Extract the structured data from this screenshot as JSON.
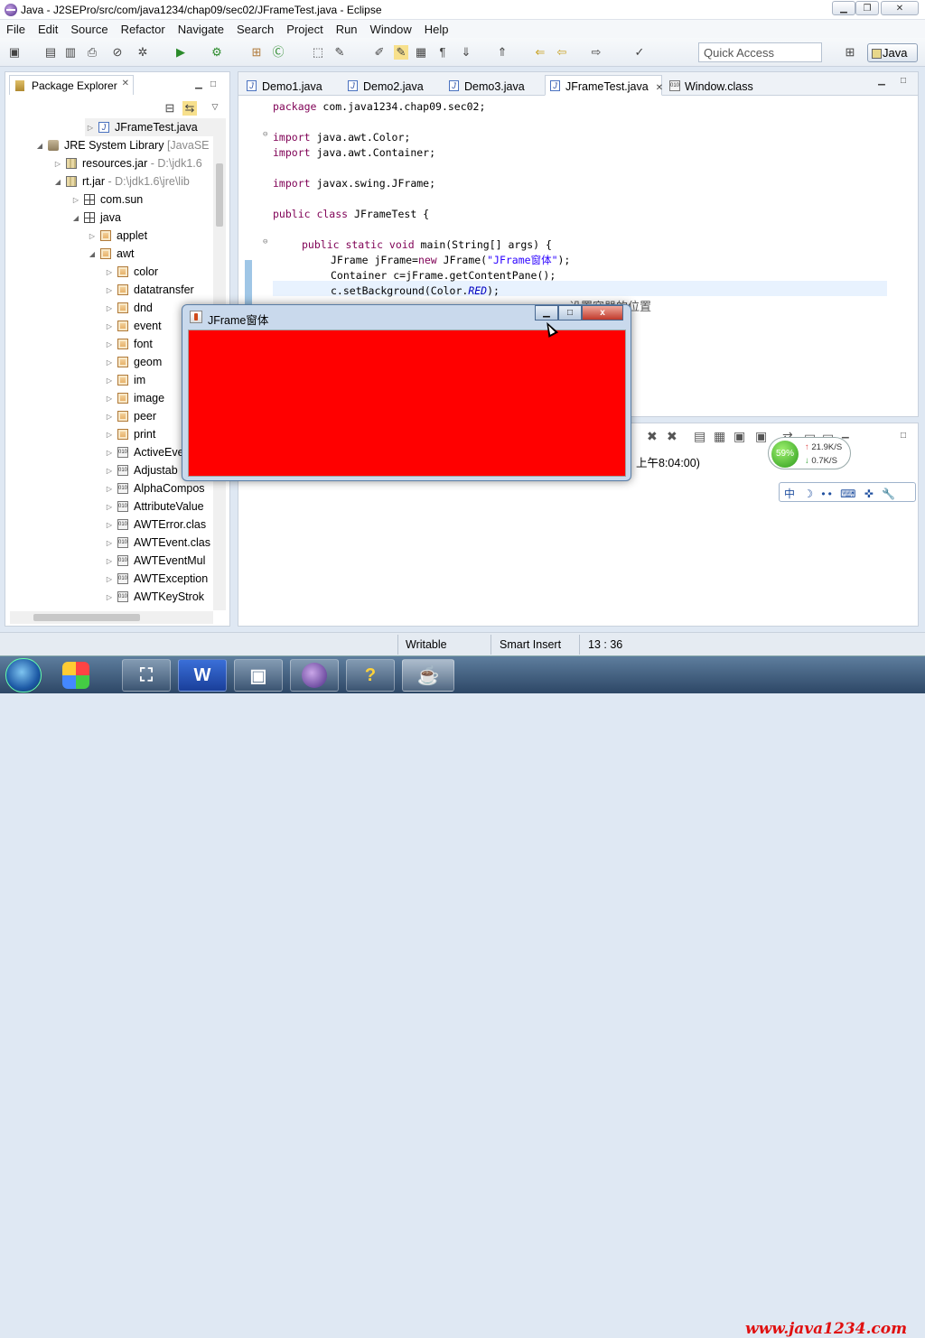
{
  "window": {
    "title": "Java - J2SEPro/src/com/java1234/chap09/sec02/JFrameTest.java - Eclipse"
  },
  "menu": [
    "File",
    "Edit",
    "Source",
    "Refactor",
    "Navigate",
    "Search",
    "Project",
    "Run",
    "Window",
    "Help"
  ],
  "toolbar": {
    "quick_access": "Quick Access",
    "perspective": "Java"
  },
  "package_explorer": {
    "tab_label": "Package Explorer",
    "items": [
      {
        "label": "JFrameTest.java",
        "suffix": ""
      },
      {
        "label": "JRE System Library",
        "suffix": "[JavaSE"
      },
      {
        "label": "resources.jar",
        "suffix": "- D:\\jdk1.6"
      },
      {
        "label": "rt.jar",
        "suffix": "- D:\\jdk1.6\\jre\\lib"
      },
      {
        "label": "com.sun",
        "suffix": ""
      },
      {
        "label": "java",
        "suffix": ""
      },
      {
        "label": "applet",
        "suffix": ""
      },
      {
        "label": "awt",
        "suffix": ""
      },
      {
        "label": "color",
        "suffix": ""
      },
      {
        "label": "datatransfer",
        "suffix": ""
      },
      {
        "label": "dnd",
        "suffix": ""
      },
      {
        "label": "event",
        "suffix": ""
      },
      {
        "label": "font",
        "suffix": ""
      },
      {
        "label": "geom",
        "suffix": ""
      },
      {
        "label": "im",
        "suffix": ""
      },
      {
        "label": "image",
        "suffix": ""
      },
      {
        "label": "peer",
        "suffix": ""
      },
      {
        "label": "print",
        "suffix": ""
      },
      {
        "label": "ActiveEve",
        "suffix": ""
      },
      {
        "label": "Adjustab",
        "suffix": ""
      },
      {
        "label": "AlphaCompos",
        "suffix": ""
      },
      {
        "label": "AttributeValue",
        "suffix": ""
      },
      {
        "label": "AWTError.clas",
        "suffix": ""
      },
      {
        "label": "AWTEvent.clas",
        "suffix": ""
      },
      {
        "label": "AWTEventMul",
        "suffix": ""
      },
      {
        "label": "AWTException",
        "suffix": ""
      },
      {
        "label": "AWTKeyStrok",
        "suffix": ""
      }
    ]
  },
  "editor": {
    "tabs": [
      "Demo1.java",
      "Demo2.java",
      "Demo3.java",
      "JFrameTest.java",
      "Window.class"
    ],
    "code": {
      "l1_kw": "package",
      "l1_rest": " com.java1234.chap09.sec02;",
      "l2_kw": "import",
      "l2_rest": " java.awt.Color;",
      "l3_kw": "import",
      "l3_rest": " java.awt.Container;",
      "l4_kw": "import",
      "l4_rest": " javax.swing.JFrame;",
      "l5_kw": "public class",
      "l5_rest": " JFrameTest {",
      "l6_kw": "public static void",
      "l6_rest": " main(String[] args) {",
      "l7_a": "JFrame jFrame=",
      "l7_kw": "new",
      "l7_b": " JFrame(",
      "l7_str": "\"JFrame窗体\"",
      "l7_c": ");",
      "l8": "Container c=jFrame.getContentPane();",
      "l9_a": "c.setBackground(Color.",
      "l9_const": "RED",
      "l9_b": ");",
      "comment": "设置容器的位置"
    }
  },
  "console": {
    "text": "上午8:04:00)"
  },
  "net_widget": {
    "percent": "59%",
    "up": "21.9K/S",
    "down": "0.7K/S"
  },
  "ime": {
    "text": "中 ☽ •• ⌨ ✜ 🔧"
  },
  "statusbar": {
    "writable": "Writable",
    "insert_mode": "Smart Insert",
    "position": "13 : 36"
  },
  "jframe": {
    "title": "JFrame窗体",
    "background": "#ff0000"
  },
  "taskbar": {
    "watermark": "www.java1234.com"
  }
}
